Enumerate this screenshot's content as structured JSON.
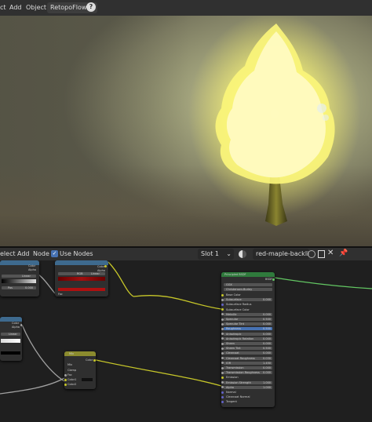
{
  "header": {
    "menu": [
      "ct",
      "Add",
      "Object"
    ],
    "addon": "RetopoFlow",
    "addon_arrow": "⌄",
    "help": "?"
  },
  "node_header": {
    "menu": [
      "elect",
      "Add",
      "Node"
    ],
    "use_nodes_label": "Use Nodes",
    "slot": "Slot 1",
    "material": "red-maple-backlight..."
  },
  "nodes": {
    "principled": {
      "title": "Principled BSDF",
      "output": "BSDF",
      "dist": "GGX",
      "sss": "Christensen-Burley",
      "rows": [
        "Base Color",
        "Subsurface",
        "Subsurface Radius",
        "Subsurface Color",
        "Metallic",
        "Specular",
        "Specular Tint",
        "Roughness",
        "Anisotropic",
        "Anisotropic Rotation",
        "Sheen",
        "Sheen Tint",
        "Clearcoat",
        "Clearcoat Roughness",
        "IOR",
        "Transmission",
        "Transmission Roughness",
        "Emission",
        "Emission Strength",
        "Alpha",
        "Normal",
        "Clearcoat Normal",
        "Tangent"
      ],
      "values": [
        "",
        "0.000",
        "",
        "",
        "0.000",
        "0.500",
        "0.000",
        "0.500",
        "0.000",
        "0.000",
        "0.000",
        "0.500",
        "0.000",
        "0.030",
        "1.450",
        "0.000",
        "0.000",
        "",
        "1.000",
        "1.000",
        "",
        "",
        ""
      ]
    },
    "mix": {
      "title": "Mix",
      "out": "Color",
      "mode": "Mix",
      "clamp": "Clamp",
      "fac": "Fac",
      "c1": "Color1",
      "c2": "Color2"
    },
    "ramp": {
      "out1": "Color",
      "out2": "Alpha",
      "mode": "RGB",
      "interp": "Linear",
      "fac": "Fac"
    },
    "left_top": {
      "out1": "Color",
      "out2": "Alpha",
      "interp": "Linear",
      "pos": "Pos",
      "val": "0.000"
    },
    "left_mid": {
      "out1": "Color",
      "out2": "Alpha",
      "interp": "Linear"
    }
  }
}
